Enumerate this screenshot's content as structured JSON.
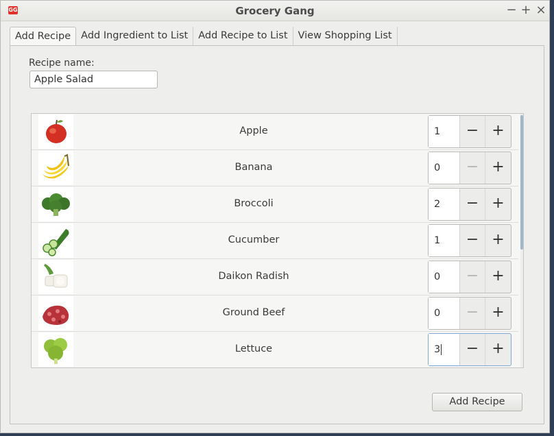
{
  "window": {
    "title": "Grocery Gang",
    "icon_text": "GG",
    "minimize": "−",
    "maximize": "+",
    "close": "×"
  },
  "tabs": [
    {
      "label": "Add Recipe",
      "active": true
    },
    {
      "label": "Add Ingredient to List"
    },
    {
      "label": "Add Recipe to List"
    },
    {
      "label": "View Shopping List"
    }
  ],
  "form": {
    "recipe_name_label": "Recipe name:",
    "recipe_name_value": "Apple Salad"
  },
  "ingredients": [
    {
      "name": "Apple",
      "qty": "1",
      "icon": "apple-icon"
    },
    {
      "name": "Banana",
      "qty": "0",
      "icon": "banana-icon"
    },
    {
      "name": "Broccoli",
      "qty": "2",
      "icon": "broccoli-icon"
    },
    {
      "name": "Cucumber",
      "qty": "1",
      "icon": "cucumber-icon"
    },
    {
      "name": "Daikon Radish",
      "qty": "0",
      "icon": "daikon-radish-icon"
    },
    {
      "name": "Ground Beef",
      "qty": "0",
      "icon": "ground-beef-icon"
    },
    {
      "name": "Lettuce",
      "qty": "3",
      "icon": "lettuce-icon"
    }
  ],
  "spinner": {
    "minus": "−",
    "plus": "+"
  },
  "actions": {
    "add_recipe": "Add Recipe"
  }
}
